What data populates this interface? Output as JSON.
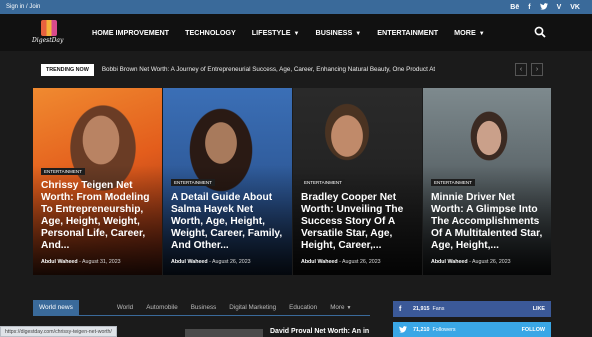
{
  "topbar": {
    "signin": "Sign in / Join",
    "social": [
      "Bē",
      "f",
      "🐦",
      "V",
      "VK"
    ]
  },
  "logo": {
    "text": "DigestDay"
  },
  "nav": [
    {
      "label": "HOME IMPROVEMENT"
    },
    {
      "label": "TECHNOLOGY"
    },
    {
      "label": "LIFESTYLE",
      "dropdown": true
    },
    {
      "label": "BUSINESS",
      "dropdown": true
    },
    {
      "label": "ENTERTAINMENT"
    },
    {
      "label": "MORE",
      "dropdown": true
    }
  ],
  "trending": {
    "label": "TRENDING NOW",
    "text": "Bobbi Brown Net Worth: A Journey of Entrepreneurial Success, Age, Career, Enhancing Natural Beauty, One Product At",
    "prev": "‹",
    "next": "›"
  },
  "cards": [
    {
      "category": "ENTERTAINMENT",
      "title": "Chrissy Teigen Net Worth: From Modeling To Entrepreneurship, Age, Height, Weight, Personal Life, Career, And...",
      "author": "Abdul Waheed",
      "date": "August 31, 2023"
    },
    {
      "category": "ENTERTAINMENT",
      "title": "A Detail Guide About Salma Hayek Net Worth, Age, Height, Weight, Career, Family, And Other...",
      "author": "Abdul Waheed",
      "date": "August 26, 2023"
    },
    {
      "category": "ENTERTAINMENT",
      "title": "Bradley Cooper Net Worth: Unveiling The Success Story Of A Versatile Star, Age, Height, Career,...",
      "author": "Abdul Waheed",
      "date": "August 26, 2023"
    },
    {
      "category": "ENTERTAINMENT",
      "title": "Minnie Driver Net Worth: A Glimpse Into The Accomplishments Of A Multitalented Star, Age, Height,...",
      "author": "Abdul Waheed",
      "date": "August 26, 2023"
    }
  ],
  "tabs": {
    "lead": "World news",
    "items": [
      "World",
      "Automobile",
      "Business",
      "Digital Marketing",
      "Education"
    ],
    "more": "More"
  },
  "social_counters": [
    {
      "icon": "f",
      "count": "21,915",
      "label": "Fans",
      "action": "LIKE",
      "color": "#3b5998"
    },
    {
      "icon": "t",
      "count": "71,210",
      "label": "Followers",
      "action": "FOLLOW",
      "color": "#3aa7e6"
    }
  ],
  "latest": {
    "title": "David Proval Net Worth: An in"
  },
  "status_url": "https://digestday.com/chrissy-teigen-net-worth/"
}
